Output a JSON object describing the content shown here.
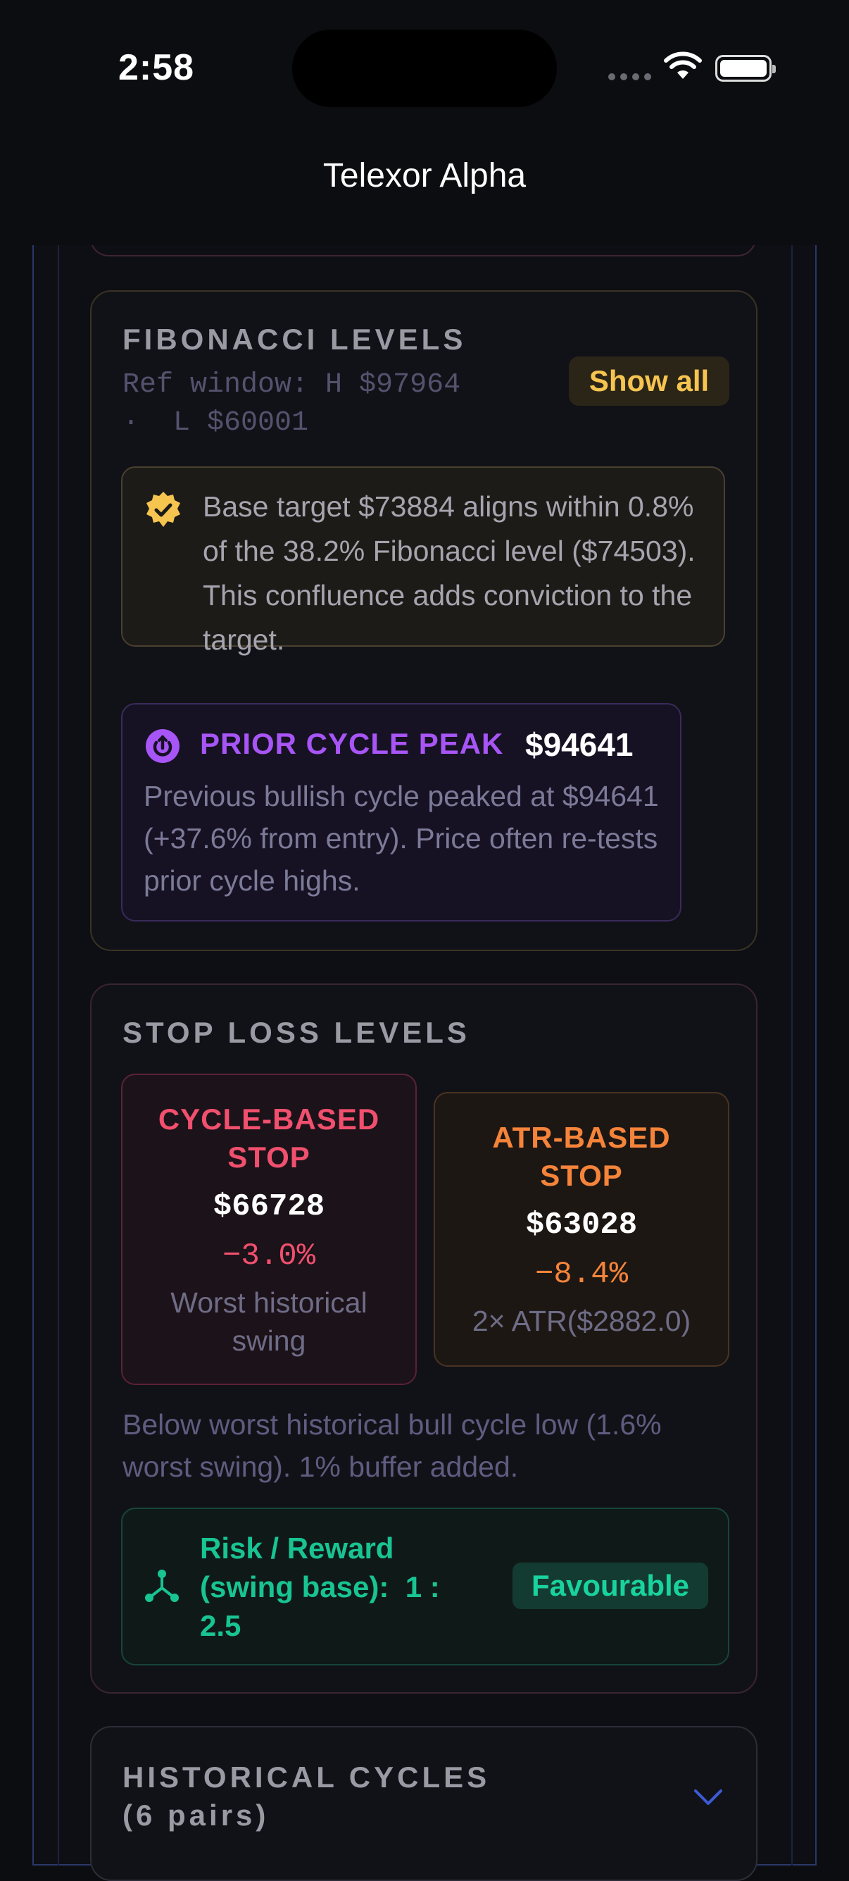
{
  "status_bar": {
    "time": "2:58"
  },
  "nav": {
    "title": "Telexor Alpha"
  },
  "fibonacci": {
    "section_title": "FIBONACCI LEVELS",
    "ref_window_line1": "Ref window: H $97964",
    "ref_window_line2": "·  L $60001",
    "show_all_label": "Show all",
    "confluence_text": "Base target $73884 aligns within 0.8% of the 38.2% Fibonacci level ($74503). This confluence adds conviction to the target.",
    "prior_cycle_peak": {
      "label": "PRIOR CYCLE PEAK",
      "value": "$94641",
      "description": "Previous bullish cycle peaked at $94641 (+37.6% from entry). Price often re-tests prior cycle highs."
    }
  },
  "stop_loss": {
    "section_title": "STOP LOSS LEVELS",
    "cycle_stop": {
      "title_line1": "CYCLE-BASED",
      "title_line2": "STOP",
      "price": "$66728",
      "pct": "−3.0%",
      "desc_line1": "Worst historical",
      "desc_line2": "swing"
    },
    "atr_stop": {
      "title_line1": "ATR-BASED",
      "title_line2": "STOP",
      "price": "$63028",
      "pct": "−8.4%",
      "desc": "2× ATR($2882.0)"
    },
    "note": "Below worst historical bull cycle low (1.6% worst swing). 1% buffer added.",
    "risk_reward": {
      "line1": "Risk / Reward",
      "line2": "(swing base):  1 :",
      "line3": "2.5",
      "badge": "Favourable"
    }
  },
  "historical_cycles": {
    "title_line1": "HISTORICAL CYCLES",
    "title_line2": "(6 pairs)"
  },
  "colors": {
    "accent_gold": "#f6c54f",
    "accent_purple": "#a855f7",
    "stop_red": "#f0506e",
    "stop_orange": "#f5843a",
    "rr_green": "#19c493"
  },
  "icons": [
    "wifi-icon",
    "battery-icon",
    "verified-badge-icon",
    "cycle-peak-icon",
    "risk-reward-icon",
    "chevron-down-icon"
  ]
}
